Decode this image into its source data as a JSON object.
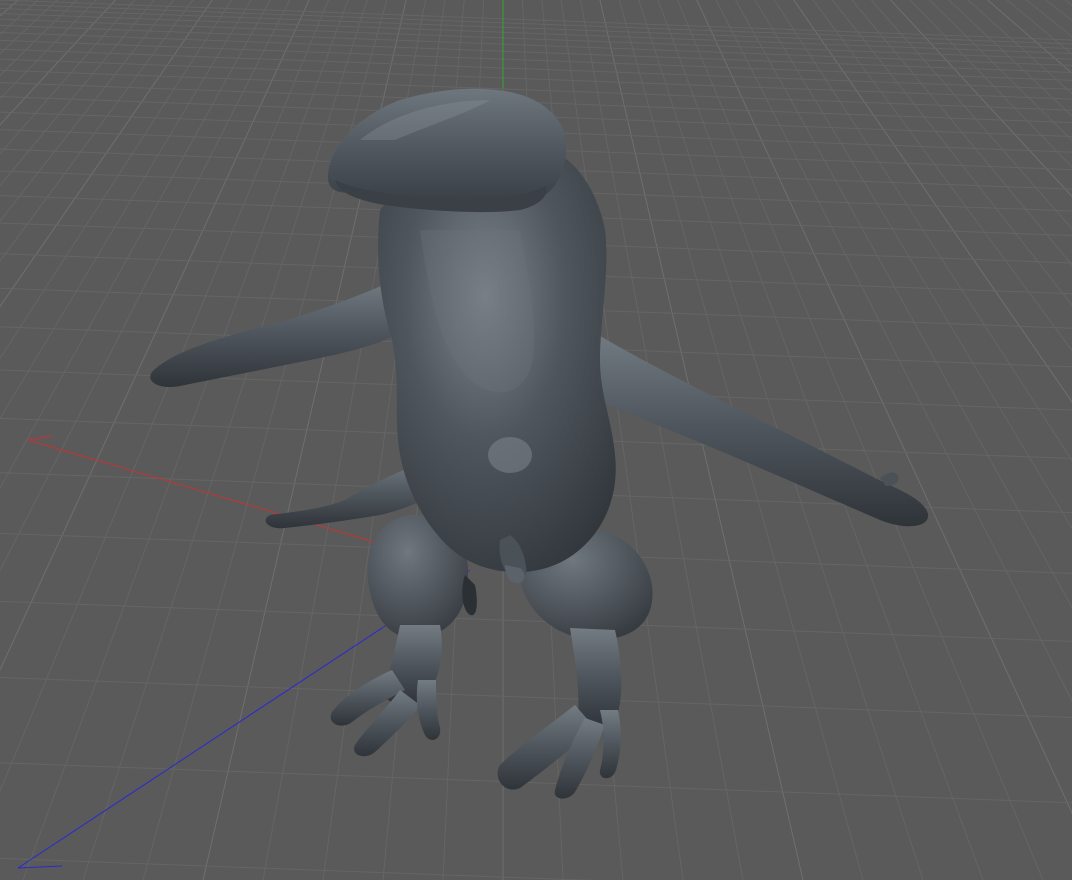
{
  "viewport": {
    "view": "perspective",
    "background_color": "#5a5a5a",
    "grid": {
      "visible": true,
      "line_color": "#6f6f6f",
      "minor_line_color": "#656565"
    },
    "axes": {
      "x_color": "#c83232",
      "y_color": "#2faa2f",
      "z_color": "#2a2ad0"
    },
    "object": {
      "kind": "sculpted character mesh",
      "pose": "T-pose",
      "material_color": "#4c5258",
      "highlight_color": "#8c949c",
      "shadow_color": "#2e3338"
    }
  }
}
